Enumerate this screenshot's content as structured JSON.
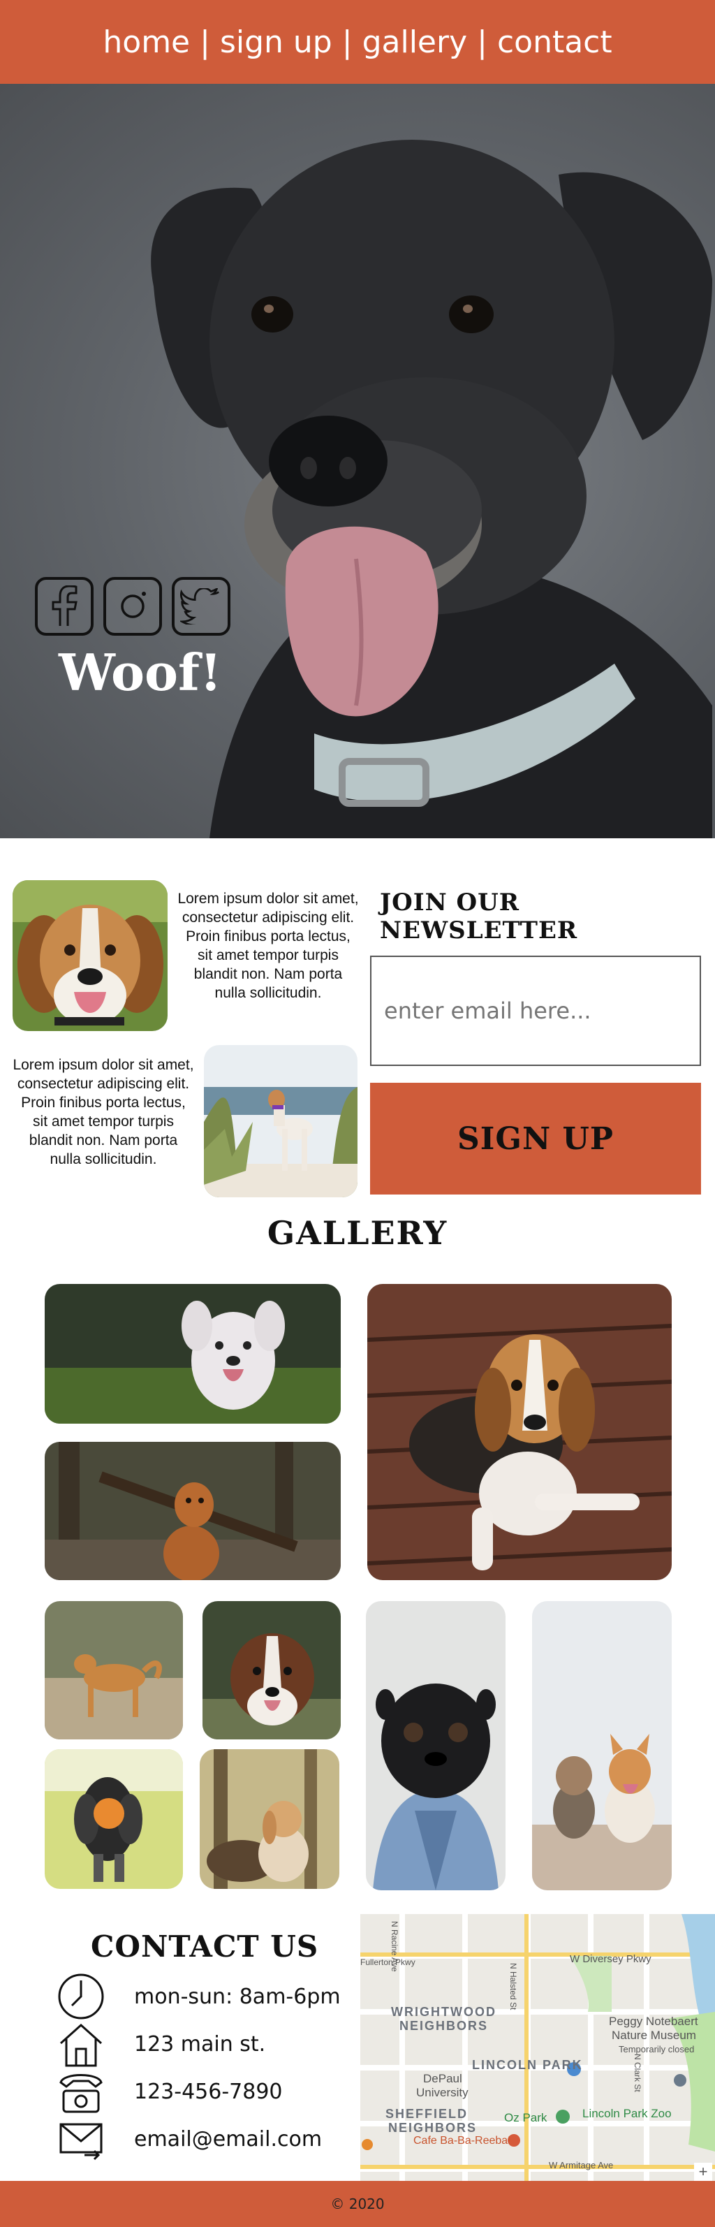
{
  "nav": {
    "links": [
      "home",
      "sign up",
      "gallery",
      "contact"
    ],
    "separator": "|"
  },
  "hero": {
    "title": "Woof!",
    "social_icons": [
      "facebook-icon",
      "instagram-icon",
      "twitter-icon"
    ]
  },
  "about": {
    "blurb_1": "Lorem ipsum dolor sit amet, consectetur adipiscing elit. Proin finibus porta lectus, sit amet tempor turpis blandit non. Nam porta nulla sollicitudin.",
    "blurb_2": "Lorem ipsum dolor sit amet, consectetur adipiscing elit. Proin finibus porta lectus, sit amet tempor turpis blandit non. Nam porta nulla sollicitudin."
  },
  "newsletter": {
    "title": "JOIN OUR NEWSLETTER",
    "placeholder": "enter email here...",
    "button": "SIGN UP"
  },
  "gallery": {
    "title": "GALLERY"
  },
  "contact": {
    "title": "CONTACT US",
    "rows": [
      {
        "icon": "clock-icon",
        "text": "mon-sun: 8am-6pm"
      },
      {
        "icon": "house-icon",
        "text": "123 main st."
      },
      {
        "icon": "phone-icon",
        "text": "123-456-7890"
      },
      {
        "icon": "mail-icon",
        "text": "email@email.com"
      }
    ]
  },
  "map": {
    "labels": [
      "W Diversey Pkwy",
      "WRIGHTWOOD",
      "NEIGHBORS",
      "Peggy Notebaert",
      "Nature Museum",
      "Temporarily closed",
      "LINCOLN PARK",
      "DePaul",
      "University",
      "SHEFFIELD",
      "NEIGHBORS",
      "Oz Park",
      "Lincoln Park Zoo",
      "Cafe Ba-Ba-Reeba!",
      "W Armitage Ave",
      "N Halsted St",
      "N Clark St",
      "N Racine Ave",
      "Fullerton Pkwy"
    ]
  },
  "footer": {
    "text": "© 2020"
  },
  "colors": {
    "accent": "#cf5c3a"
  }
}
